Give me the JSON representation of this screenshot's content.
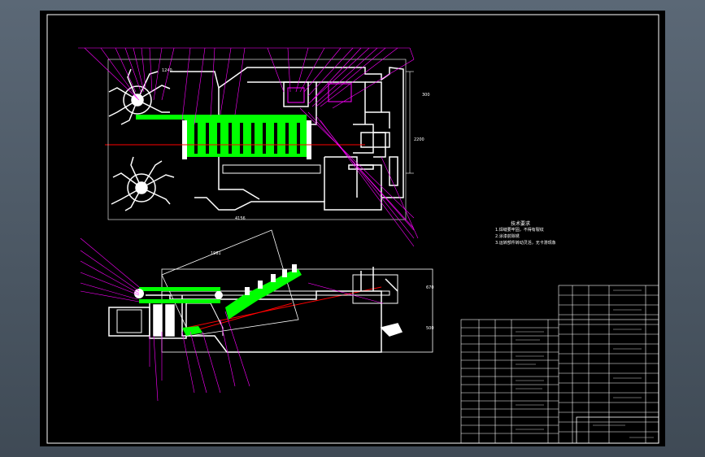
{
  "drawing": {
    "dimensions": {
      "top_width": "4156",
      "height_a": "300",
      "height_b": "2200",
      "side_width": "1961",
      "side_height_a": "670",
      "side_height_b": "500",
      "left_dim": "1240"
    },
    "notes": {
      "title": "技术要求",
      "lines": [
        "1.焊缝要牢固，不得有裂纹",
        "2.涂漆前除锈",
        "3.运转部件转动灵活，无卡滞现象"
      ]
    },
    "colors": {
      "background": "#000000",
      "frame": "#ffffff",
      "leader": "#ff00ff",
      "highlight": "#00ff00",
      "centerline": "#ff0000"
    }
  }
}
